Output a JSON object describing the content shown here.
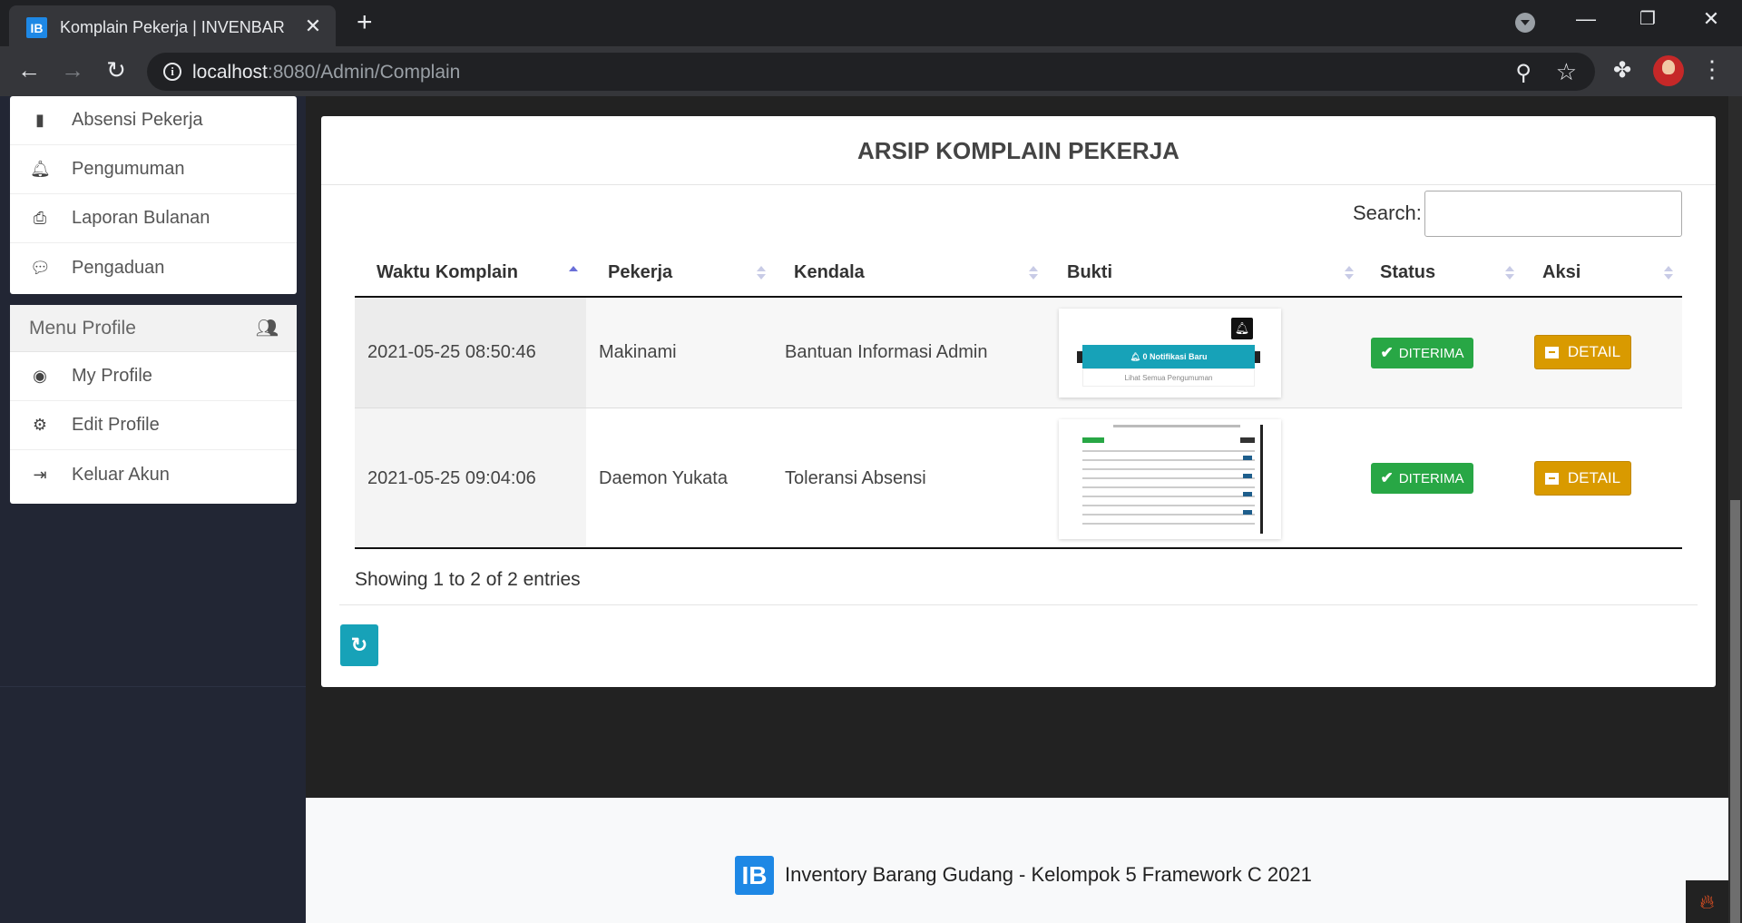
{
  "browser": {
    "tab_title": "Komplain Pekerja | INVENBAR",
    "favicon_text": "IB",
    "url_host": "localhost",
    "url_path": ":8080/Admin/Complain"
  },
  "sidebar": {
    "main_items": [
      {
        "label": "Absensi Pekerja",
        "icon": "clipboard-icon"
      },
      {
        "label": "Pengumuman",
        "icon": "bell-icon"
      },
      {
        "label": "Laporan Bulanan",
        "icon": "print-icon"
      },
      {
        "label": "Pengaduan",
        "icon": "comment-icon"
      }
    ],
    "profile_header": "Menu Profile",
    "profile_items": [
      {
        "label": "My Profile",
        "icon": "user-circle-icon"
      },
      {
        "label": "Edit Profile",
        "icon": "user-cog-icon"
      },
      {
        "label": "Keluar Akun",
        "icon": "sign-out-icon"
      }
    ]
  },
  "card": {
    "title": "ARSIP KOMPLAIN PEKERJA",
    "search_label": "Search:",
    "search_value": "",
    "columns": [
      "Waktu Komplain",
      "Pekerja",
      "Kendala",
      "Bukti",
      "Status",
      "Aksi"
    ],
    "rows": [
      {
        "waktu": "2021-05-25 08:50:46",
        "pekerja": "Makinami",
        "kendala": "Bantuan Informasi Admin",
        "status": "DITERIMA",
        "aksi": "DETAIL",
        "bukti_caption": "0 Notifikasi Baru",
        "bukti_link": "Lihat Semua Pengumuman"
      },
      {
        "waktu": "2021-05-25 09:04:06",
        "pekerja": "Daemon Yukata",
        "kendala": "Toleransi Absensi",
        "status": "DITERIMA",
        "aksi": "DETAIL"
      }
    ],
    "showing": "Showing 1 to 2 of 2 entries"
  },
  "footer": {
    "logo_text": "IB",
    "text": "Inventory Barang Gudang - Kelompok 5 Framework C 2021"
  },
  "colors": {
    "status_ok": "#28a745",
    "detail_button": "#d99a00",
    "refresh_button": "#17a2b8",
    "brand": "#1e88e5"
  }
}
